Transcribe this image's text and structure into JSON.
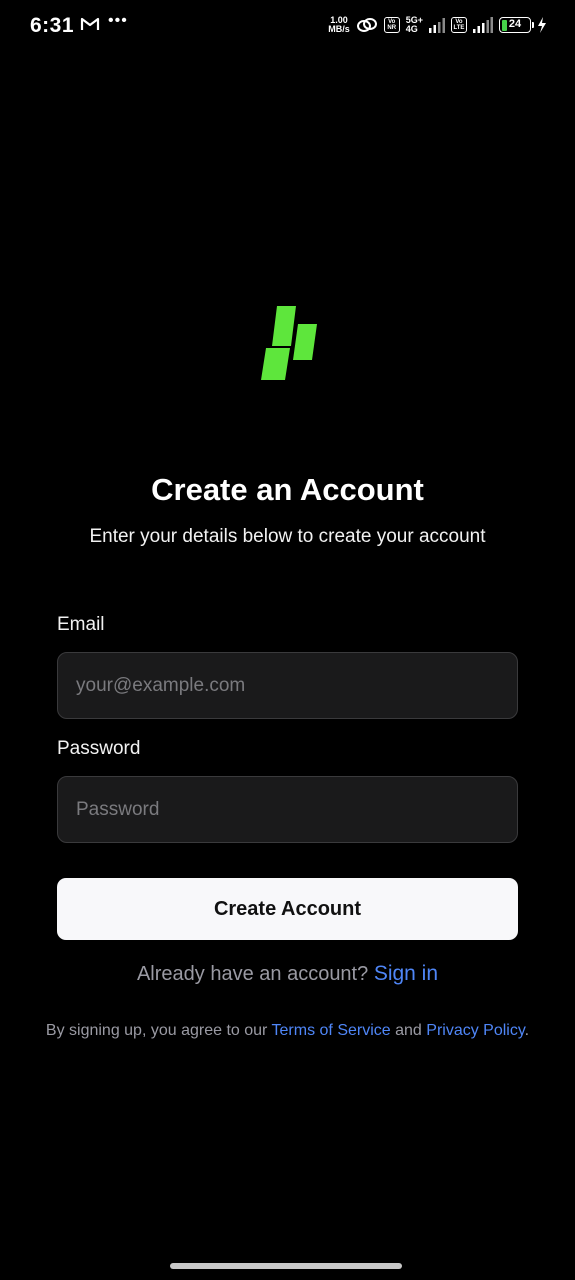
{
  "status_bar": {
    "time": "6:31",
    "net_speed_value": "1.00",
    "net_speed_unit": "MB/s",
    "volte1_top": "Vo",
    "volte1_bottom": "NR",
    "network_type": "5G+",
    "network_sub": "4G",
    "volte2_top": "Vo",
    "volte2_bottom": "LTE",
    "battery_level": "24",
    "icons": [
      "gmail-icon",
      "more-dots-icon",
      "link-icon",
      "signal-icon",
      "battery-icon",
      "charging-bolt-icon"
    ]
  },
  "brand": {
    "logo_color": "#5ee63c"
  },
  "header": {
    "title": "Create an Account",
    "subtitle": "Enter your details below to create your account"
  },
  "form": {
    "email_label": "Email",
    "email_placeholder": "your@example.com",
    "email_value": "",
    "password_label": "Password",
    "password_placeholder": "Password",
    "password_value": "",
    "submit_label": "Create Account"
  },
  "signin": {
    "prompt": "Already have an account?",
    "link_label": "Sign in"
  },
  "terms": {
    "prefix": "By signing up, you agree to our ",
    "terms_link": "Terms of Service",
    "and": " and ",
    "privacy_link": "Privacy Policy",
    "suffix": "."
  },
  "colors": {
    "background": "#000000",
    "link": "#4f86f7",
    "button_bg": "#f8f8fa",
    "input_bg": "#1a1a1b"
  }
}
